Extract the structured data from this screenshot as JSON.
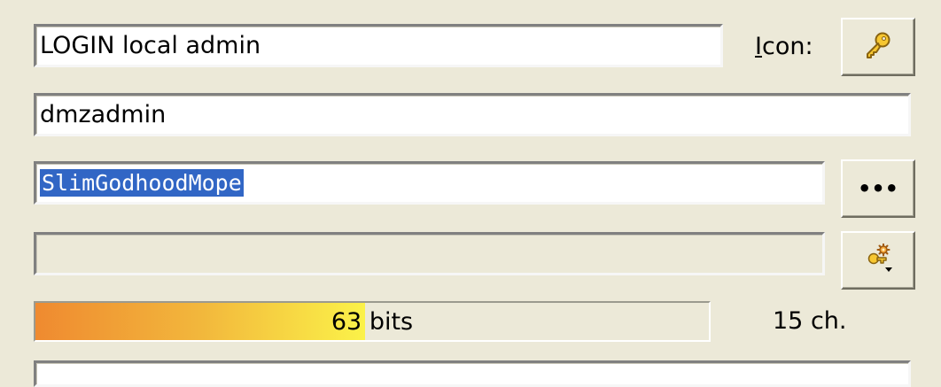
{
  "entry": {
    "title_value": "LOGIN local admin",
    "icon_label_mnemonic": "I",
    "icon_label_rest": "con:",
    "username_value": "dmzadmin",
    "password_value": "SlimGodhoodMope",
    "repeat_password_value": "",
    "show_password_button_label": "•••",
    "quality": {
      "fraction": 0.49,
      "text": "63 bits"
    },
    "length_text": "15 ch.",
    "icons": {
      "entry_icon": "key-icon",
      "generator": "key-gear-dropdown-icon"
    },
    "colors": {
      "selection": "#3166c5",
      "quality_start": "#ef8a30",
      "quality_end": "#fbf249"
    }
  }
}
